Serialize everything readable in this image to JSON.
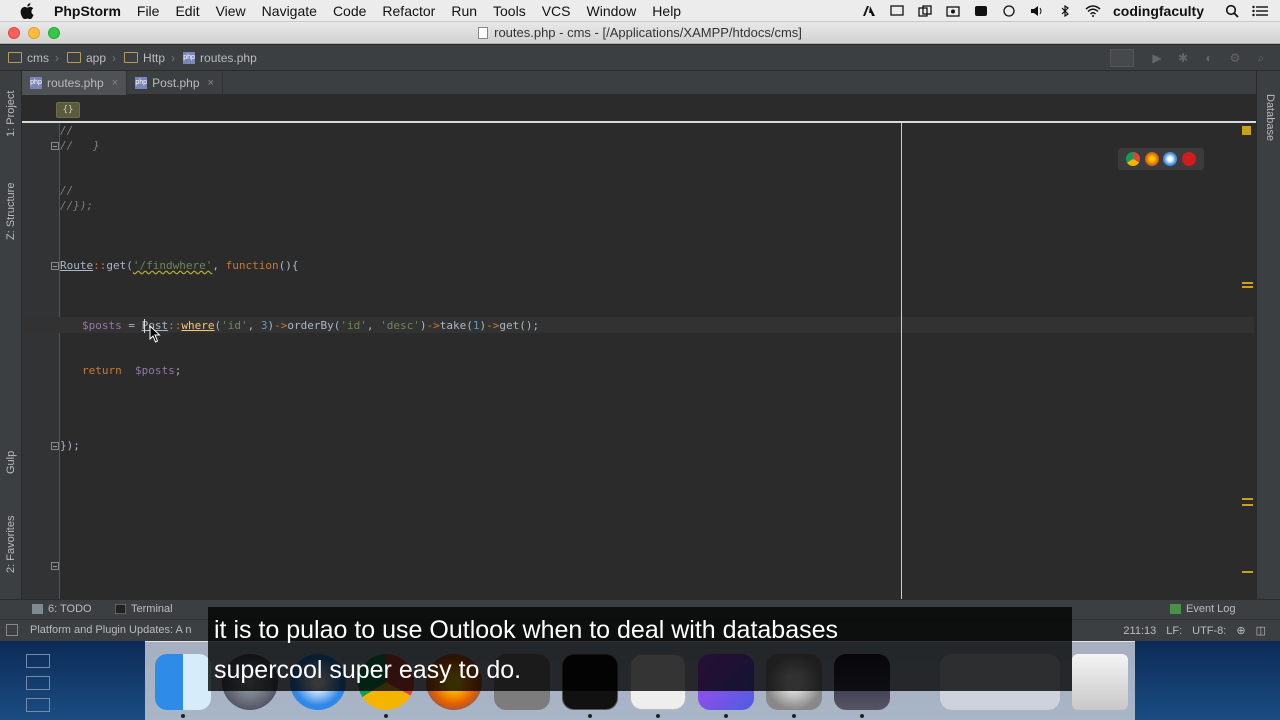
{
  "menubar": {
    "app_name": "PhpStorm",
    "items": [
      "File",
      "Edit",
      "View",
      "Navigate",
      "Code",
      "Refactor",
      "Run",
      "Tools",
      "VCS",
      "Window",
      "Help"
    ],
    "user": "codingfaculty"
  },
  "window": {
    "title": "routes.php - cms - [/Applications/XAMPP/htdocs/cms]"
  },
  "breadcrumb": [
    "cms",
    "app",
    "Http",
    "routes.php"
  ],
  "tabs": [
    {
      "label": "routes.php",
      "active": true
    },
    {
      "label": "Post.php",
      "active": false
    }
  ],
  "side_tabs": {
    "project": "1: Project",
    "structure": "Z: Structure",
    "gulp": "Gulp",
    "favorites": "2: Favorites",
    "database": "Database"
  },
  "editor": {
    "chip": "{}",
    "line_comment_1": "//",
    "line_comment_2": "//   }",
    "line_comment_3": "//",
    "line_comment_4": "//});",
    "route": {
      "cls": "Route",
      "op": "::",
      "method": "get(",
      "path": "'/findwhere'",
      "comma": ", ",
      "kw": "function",
      "rest": "(){"
    },
    "query": {
      "var": "$posts",
      "assign": " = ",
      "cls": "Post",
      "op1": "::",
      "where": "where",
      "args1_open": "(",
      "a1": "'id'",
      "sep1": ", ",
      "n1": "3",
      "args1_close": ")",
      "arrow1": "->",
      "orderBy": "orderBy(",
      "a2": "'id'",
      "sep2": ", ",
      "a3": "'desc'",
      "close2": ")",
      "arrow2": "->",
      "take": "take(",
      "n2": "1",
      "close3": ")",
      "arrow3": "->",
      "get": "get();"
    },
    "ret": {
      "kw": "return",
      "var": "$posts",
      "semi": ";"
    },
    "closing": "});"
  },
  "bottom_tools": {
    "todo": "6: TODO",
    "terminal": "Terminal",
    "event_log": "Event Log"
  },
  "status": {
    "message": "Platform and Plugin Updates: A n",
    "position": "211:13",
    "line_sep": "LF:",
    "encoding": "UTF-8:"
  },
  "subtitles": {
    "line1": "it is to pulao to use Outlook when to deal with databases",
    "line2": "supercool super easy to do."
  },
  "colors": {
    "editor_bg": "#2b2b2b",
    "keyword": "#cc7832",
    "string": "#6a8759",
    "variable": "#9876aa",
    "number": "#6897bb",
    "comment": "#808080"
  }
}
